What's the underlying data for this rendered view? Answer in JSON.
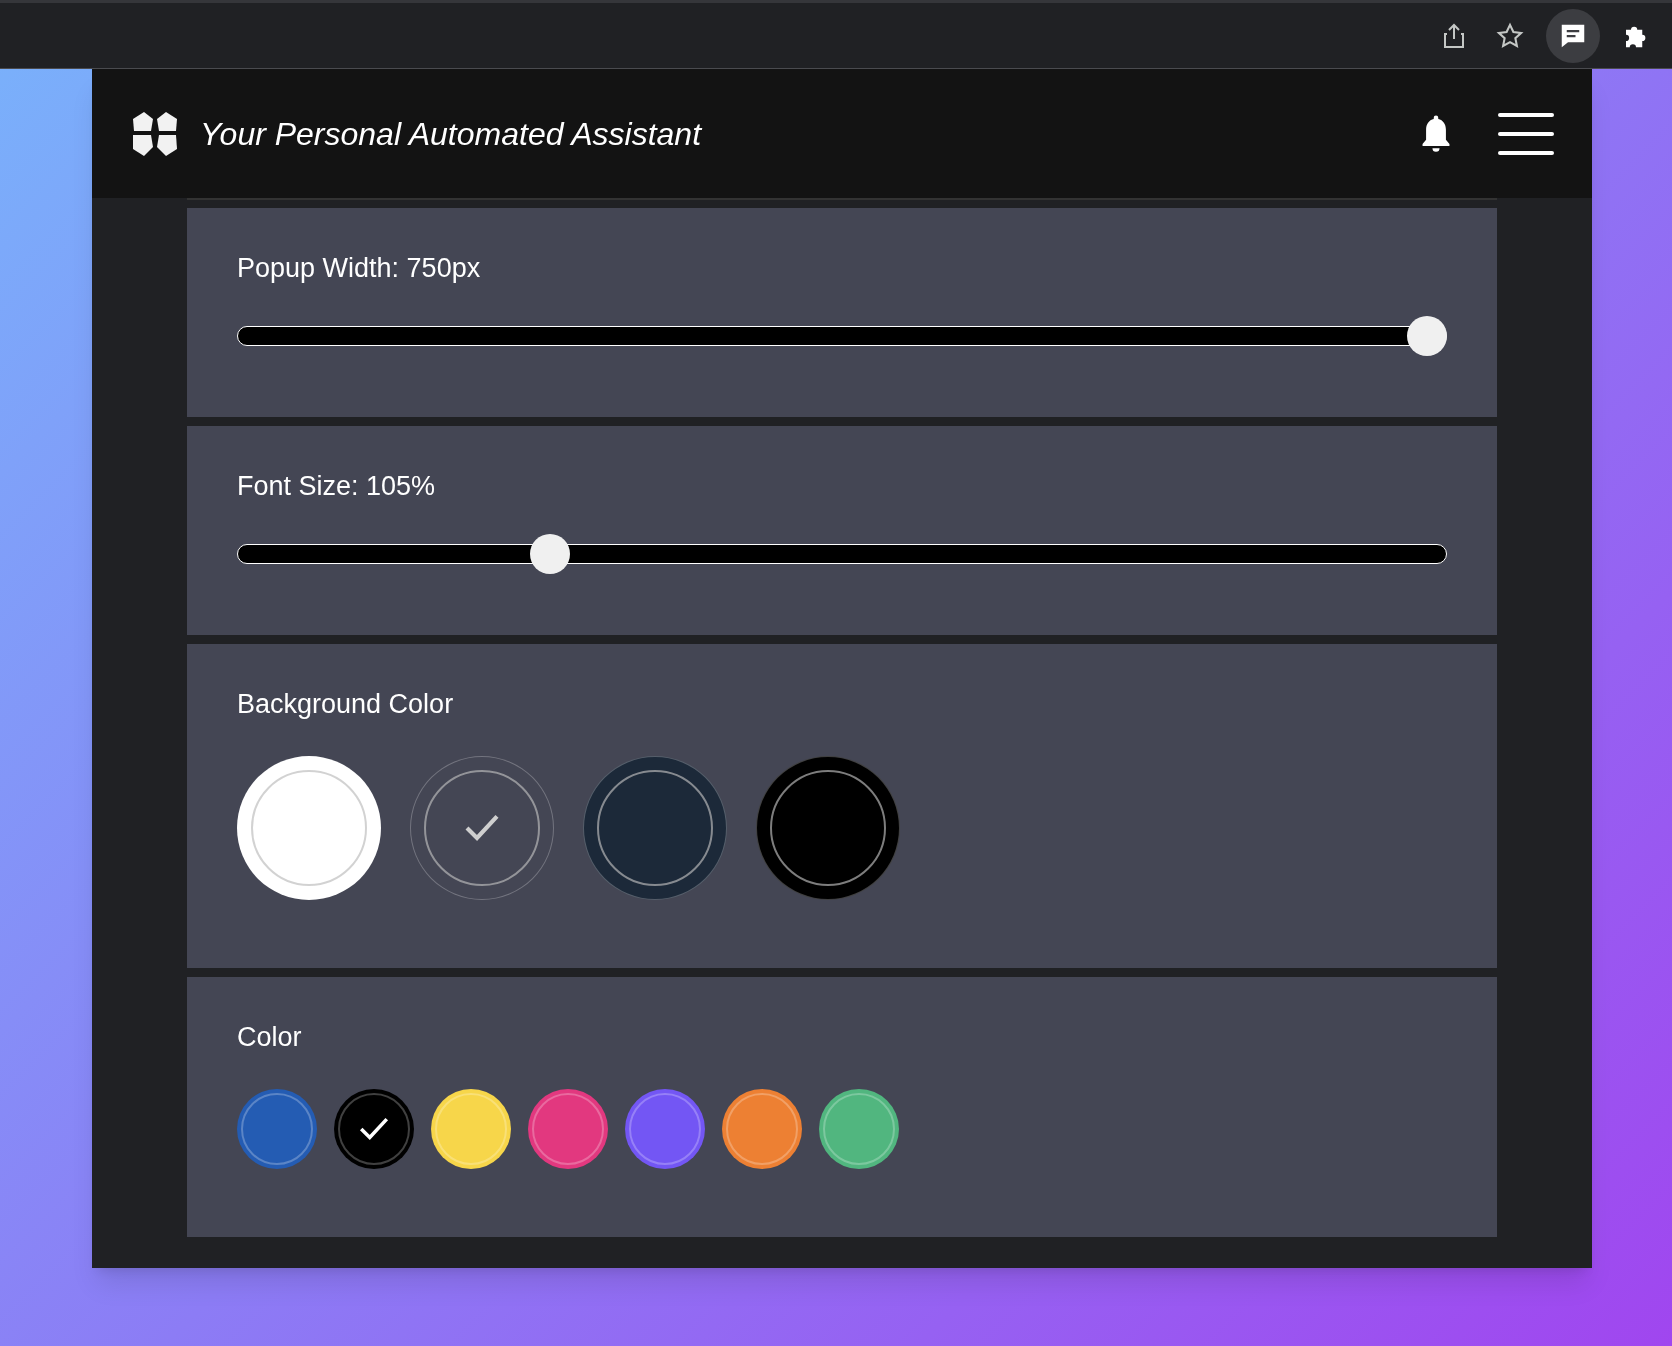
{
  "header": {
    "title": "Your Personal Automated Assistant"
  },
  "sliders": [
    {
      "label": "Popup Width: 750px",
      "level": 1.0
    },
    {
      "label": "Font Size: 105%",
      "level": 0.25
    }
  ],
  "background_color": {
    "label": "Background Color",
    "swatches": [
      {
        "color": "#ffffff",
        "selected": false
      },
      {
        "color": "#444654",
        "selected": true
      },
      {
        "color": "#1c2939",
        "selected": false
      },
      {
        "color": "#000000",
        "selected": false
      }
    ]
  },
  "accent_color": {
    "label": "Color",
    "swatches": [
      {
        "color": "#245cb3",
        "selected": false
      },
      {
        "color": "#000000",
        "selected": true
      },
      {
        "color": "#f7d64a",
        "selected": false
      },
      {
        "color": "#e2387f",
        "selected": false
      },
      {
        "color": "#7356f4",
        "selected": false
      },
      {
        "color": "#ed8033",
        "selected": false
      },
      {
        "color": "#51b67f",
        "selected": false
      }
    ]
  }
}
